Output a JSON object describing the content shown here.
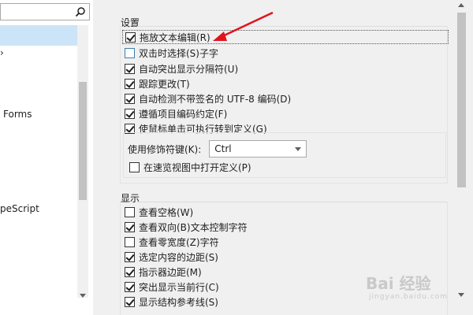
{
  "left_tree": {
    "items": [
      {
        "label": ""
      },
      {
        "label": "Forms"
      },
      {
        "label": "peScript"
      }
    ]
  },
  "settings": {
    "title": "设置",
    "options": [
      {
        "label": "拖放文本编辑(R)",
        "checked": true
      },
      {
        "label": "双击时选择(S)子字",
        "checked": false
      },
      {
        "label": "自动突出显示分隔符(U)",
        "checked": true
      },
      {
        "label": "跟踪更改(T)",
        "checked": true
      },
      {
        "label": "自动检测不带签名的 UTF-8 编码(D)",
        "checked": true
      },
      {
        "label": "遵循项目编码约定(F)",
        "checked": true
      },
      {
        "label": "使鼠标单击可执行转到定义(G)",
        "checked": true
      }
    ],
    "modifier_label": "使用修饰符键(K):",
    "modifier_value": "Ctrl",
    "peek_option": {
      "label": "在速览视图中打开定义(P)",
      "checked": false
    }
  },
  "display": {
    "title": "显示",
    "options": [
      {
        "label": "查看空格(W)",
        "checked": false
      },
      {
        "label": "查看双向(B)文本控制字符",
        "checked": true
      },
      {
        "label": "查看零宽度(Z)字符",
        "checked": false
      },
      {
        "label": "选定内容的边距(S)",
        "checked": true
      },
      {
        "label": "指示器边距(M)",
        "checked": true
      },
      {
        "label": "突出显示当前行(C)",
        "checked": true
      },
      {
        "label": "显示结构参考线(S)",
        "checked": true
      }
    ]
  },
  "watermark": {
    "text": "Bai 经验",
    "url": "jingyan.baidu.com"
  },
  "colors": {
    "accent": "#cce4f7",
    "annotation_arrow": "#e0141e"
  }
}
